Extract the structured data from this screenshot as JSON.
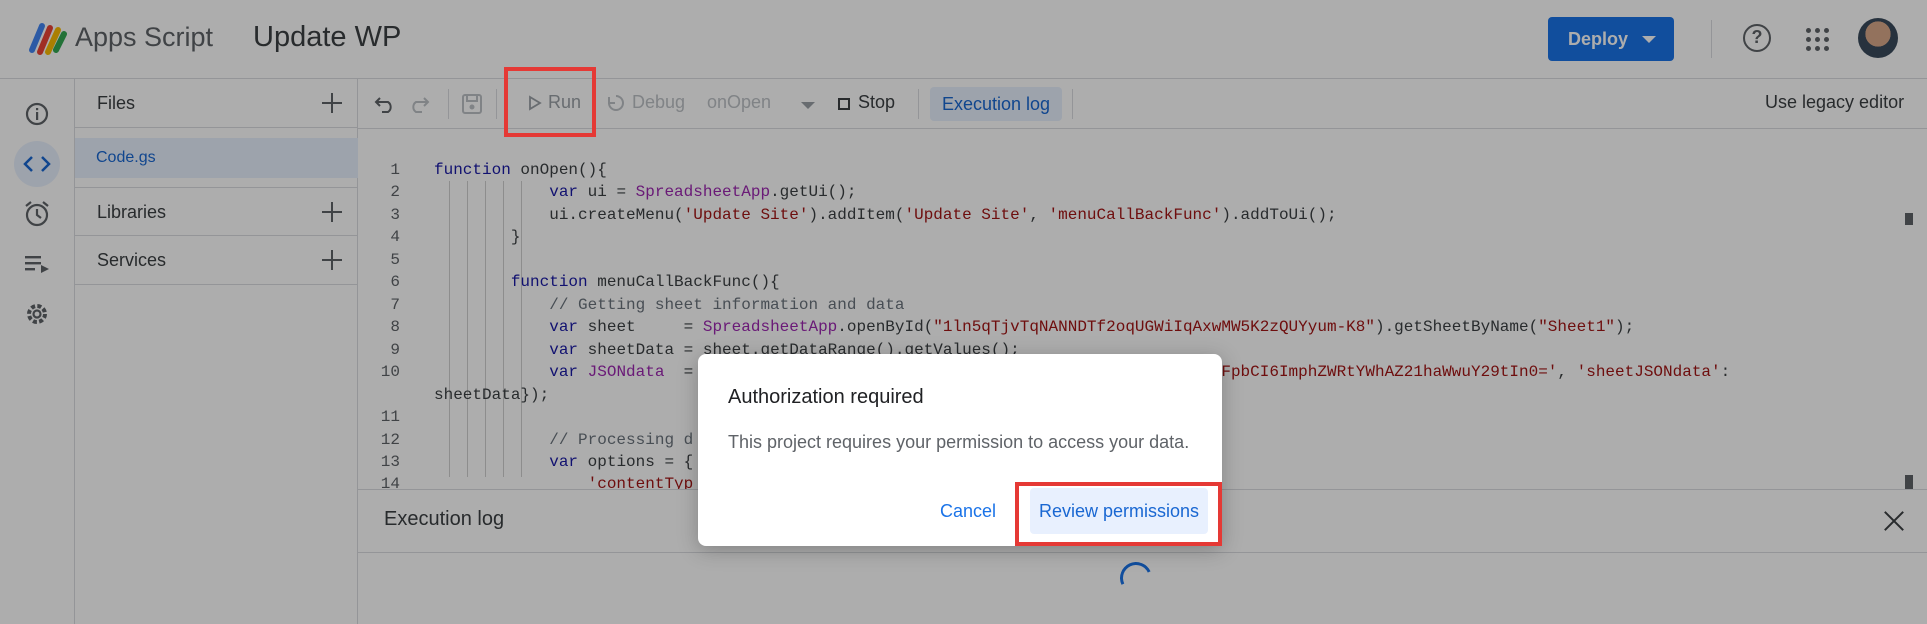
{
  "header": {
    "brand": "Apps Script",
    "project_title": "Update WP",
    "deploy_label": "Deploy"
  },
  "files_panel": {
    "files_label": "Files",
    "file_name": "Code.gs",
    "libraries_label": "Libraries",
    "services_label": "Services"
  },
  "toolbar": {
    "run_label": "Run",
    "debug_label": "Debug",
    "function_select": "onOpen",
    "stop_label": "Stop",
    "execution_log_label": "Execution log",
    "legacy_label": "Use legacy editor"
  },
  "editor": {
    "line_numbers": [
      "1",
      "2",
      "3",
      "4",
      "5",
      "6",
      "7",
      "8",
      "9",
      "10",
      "",
      "11",
      "12",
      "13",
      "14"
    ]
  },
  "log_panel": {
    "title": "Execution log"
  },
  "dialog": {
    "title": "Authorization required",
    "body": "This project requires your permission to access your data.",
    "cancel_label": "Cancel",
    "review_label": "Review permissions"
  },
  "colors": {
    "accent": "#1a73e8",
    "highlight_box": "#e53935",
    "selected_bg": "#e8f0fe"
  }
}
